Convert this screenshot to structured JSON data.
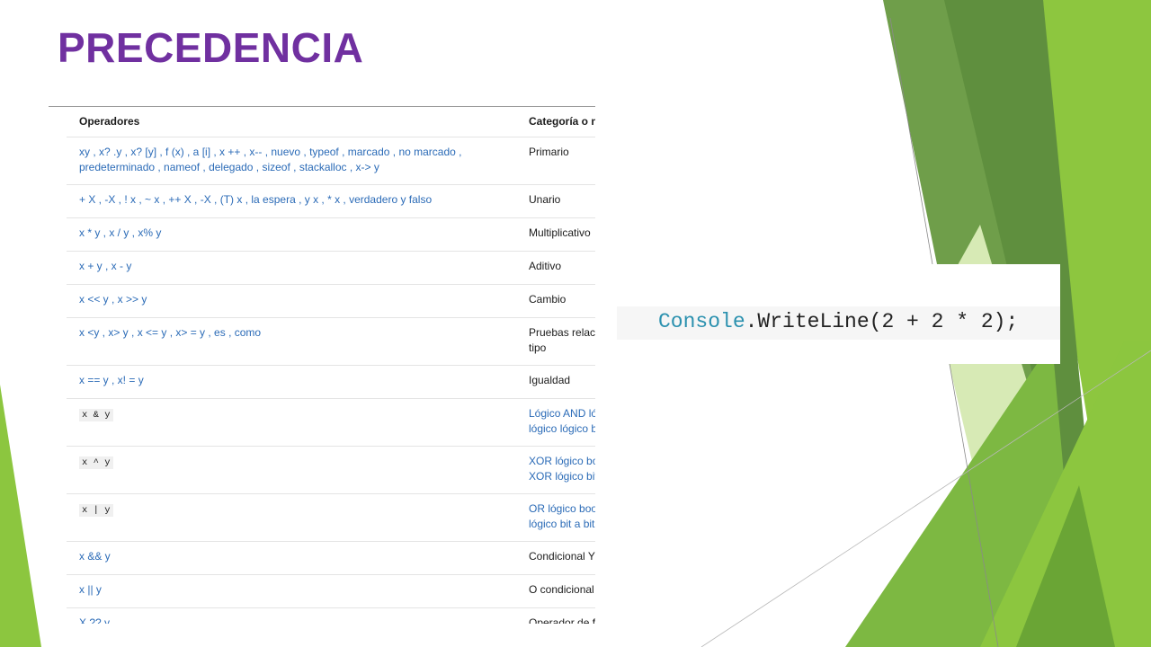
{
  "slide": {
    "title": "PRECEDENCIA"
  },
  "table": {
    "headers": {
      "operators": "Operadores",
      "category": "Categoría o nombre"
    },
    "rows": [
      {
        "ops_lines": [
          "xy , x? .y , x? [y] , f (x) , a [i] , x ++ , x-- , nuevo , typeof , marcado , no marcado ,",
          "predeterminado , nameof , delegado , sizeof , stackalloc , x-> y"
        ],
        "cat_lines": [
          "Primario"
        ],
        "code": false,
        "cat_link": false
      },
      {
        "ops_lines": [
          "+ X , -X , ! x , ~ x , ++ X , -X , (T) x , la espera , y x , * x , verdadero y falso"
        ],
        "cat_lines": [
          "Unario"
        ],
        "code": false,
        "cat_link": false
      },
      {
        "ops_lines": [
          "x * y , x / y , x% y"
        ],
        "cat_lines": [
          "Multiplicativo"
        ],
        "code": false,
        "cat_link": false
      },
      {
        "ops_lines": [
          "x + y , x - y"
        ],
        "cat_lines": [
          "Aditivo"
        ],
        "code": false,
        "cat_link": false
      },
      {
        "ops_lines": [
          "x << y , x >> y"
        ],
        "cat_lines": [
          "Cambio"
        ],
        "code": false,
        "cat_link": false
      },
      {
        "ops_lines": [
          "x <y , x> y , x <= y , x> = y , es , como"
        ],
        "cat_lines": [
          "Pruebas relacionales y de",
          "tipo"
        ],
        "code": false,
        "cat_link": false
      },
      {
        "ops_lines": [
          "x == y , x! = y"
        ],
        "cat_lines": [
          "Igualdad"
        ],
        "code": false,
        "cat_link": false
      },
      {
        "ops_lines": [
          "x & y"
        ],
        "cat_lines": [
          "Lógico AND lógico booleano o",
          "lógico lógico bit a bit"
        ],
        "code": true,
        "cat_link": true
      },
      {
        "ops_lines": [
          "x ^ y"
        ],
        "cat_lines": [
          "XOR lógico booleano o",
          "XOR lógico bit a bit"
        ],
        "code": true,
        "cat_link": true
      },
      {
        "ops_lines": [
          "x | y"
        ],
        "cat_lines": [
          "OR lógico booleano o",
          "lógico bit a bit"
        ],
        "code": true,
        "cat_link": true
      },
      {
        "ops_lines": [
          "x && y"
        ],
        "cat_lines": [
          "Condicional Y"
        ],
        "code": false,
        "cat_link": false
      },
      {
        "ops_lines": [
          "x || y"
        ],
        "cat_lines": [
          "O condicional"
        ],
        "code": false,
        "cat_link": false
      },
      {
        "ops_lines": [
          "X ?? y"
        ],
        "cat_lines": [
          "Operador de fusión nula"
        ],
        "code": false,
        "cat_link": false
      }
    ]
  },
  "code_snippet": {
    "class_name": "Console",
    "rest": ".WriteLine(2 + 2 * 2);"
  },
  "colors": {
    "title": "#7030a0",
    "link": "#2b6bb7",
    "code_class": "#2b91af",
    "green_light": "#8dc63f",
    "green_dark": "#5f8f3e"
  }
}
